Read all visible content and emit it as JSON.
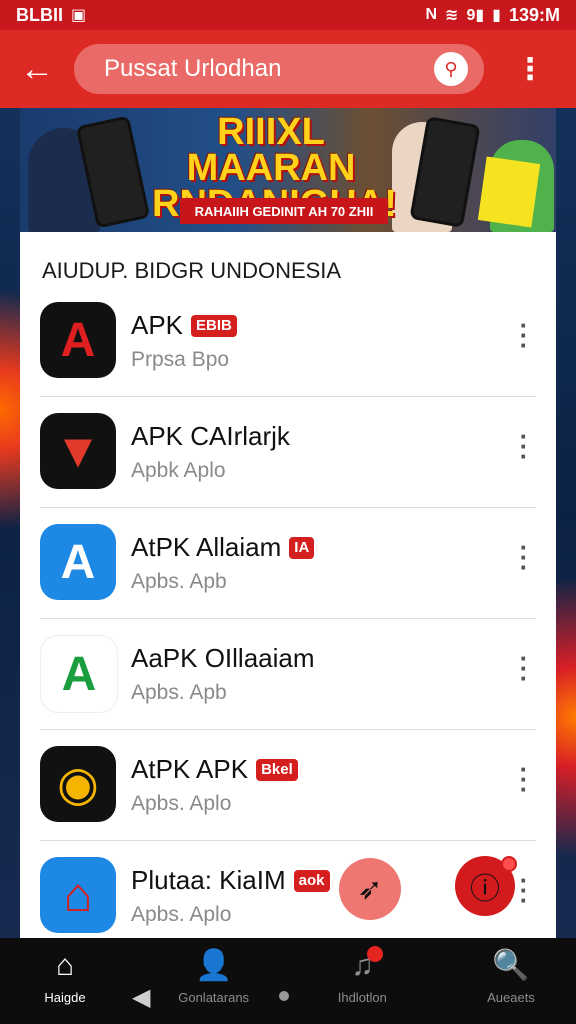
{
  "status_bar": {
    "carrier": "BLBII",
    "time": "139:M",
    "battery_text": "9"
  },
  "app_bar": {
    "search_text": "Pussat Urlodhan"
  },
  "banner": {
    "headline_line1": "RIIIXL MAARAN",
    "headline_line2": "RNDANIGHA!",
    "subline": "RAHAIIH GEDINIT AH 70 ZHII"
  },
  "list": {
    "section_title": "AIUDUP. BIDGR UNDONESIA",
    "items": [
      {
        "name": "APK",
        "badge": "EBIB",
        "sub": "Prpsa Bpo",
        "icon": "a-red-icon",
        "icon_char": "A",
        "icon_bg": "#111111",
        "icon_color": "#e02020"
      },
      {
        "name": "APK CAIrlarjk",
        "badge": "",
        "sub": "Apbk Aplo",
        "icon": "envelope-fox-icon",
        "icon_char": "▼",
        "icon_bg": "#111111",
        "icon_color": "#e23a2a"
      },
      {
        "name": "AtPK Allaiam",
        "badge": "IA",
        "sub": "Apbs. Apb",
        "icon": "a-blue-icon",
        "icon_char": "A",
        "icon_bg": "#1e88e5",
        "icon_color": "#ffffff"
      },
      {
        "name": "AaPK OIllaaiam",
        "badge": "",
        "sub": "Apbs. Apb",
        "icon": "a-green-icon",
        "icon_char": "A",
        "icon_bg": "#ffffff",
        "icon_color": "#1b9e3e"
      },
      {
        "name": "AtPK APK",
        "badge": "Bkel",
        "sub": "Apbs. Aplo",
        "icon": "chrome-icon",
        "icon_char": "◉",
        "icon_bg": "#111111",
        "icon_color": "#f4b400"
      },
      {
        "name": "Plutaa: KiaIM",
        "badge": "aok",
        "sub": "Apbs. Aplo",
        "icon": "bag-icon",
        "icon_char": "⌂",
        "icon_bg": "#1e88e5",
        "icon_color": "#d51f1f"
      }
    ]
  },
  "bottom_nav": {
    "items": [
      {
        "label": "Haigde",
        "icon": "home-icon",
        "glyph": "⌂"
      },
      {
        "label": "Gonlatarans",
        "icon": "person-icon",
        "glyph": "👤"
      },
      {
        "label": "Ihdlotlon",
        "icon": "music-note-icon",
        "glyph": "♫"
      },
      {
        "label": "Aueaets",
        "icon": "search-icon",
        "glyph": "🔍"
      }
    ]
  },
  "colors": {
    "status": "#c8171d",
    "app_bar": "#de2a24",
    "accent": "#d31a1d"
  }
}
